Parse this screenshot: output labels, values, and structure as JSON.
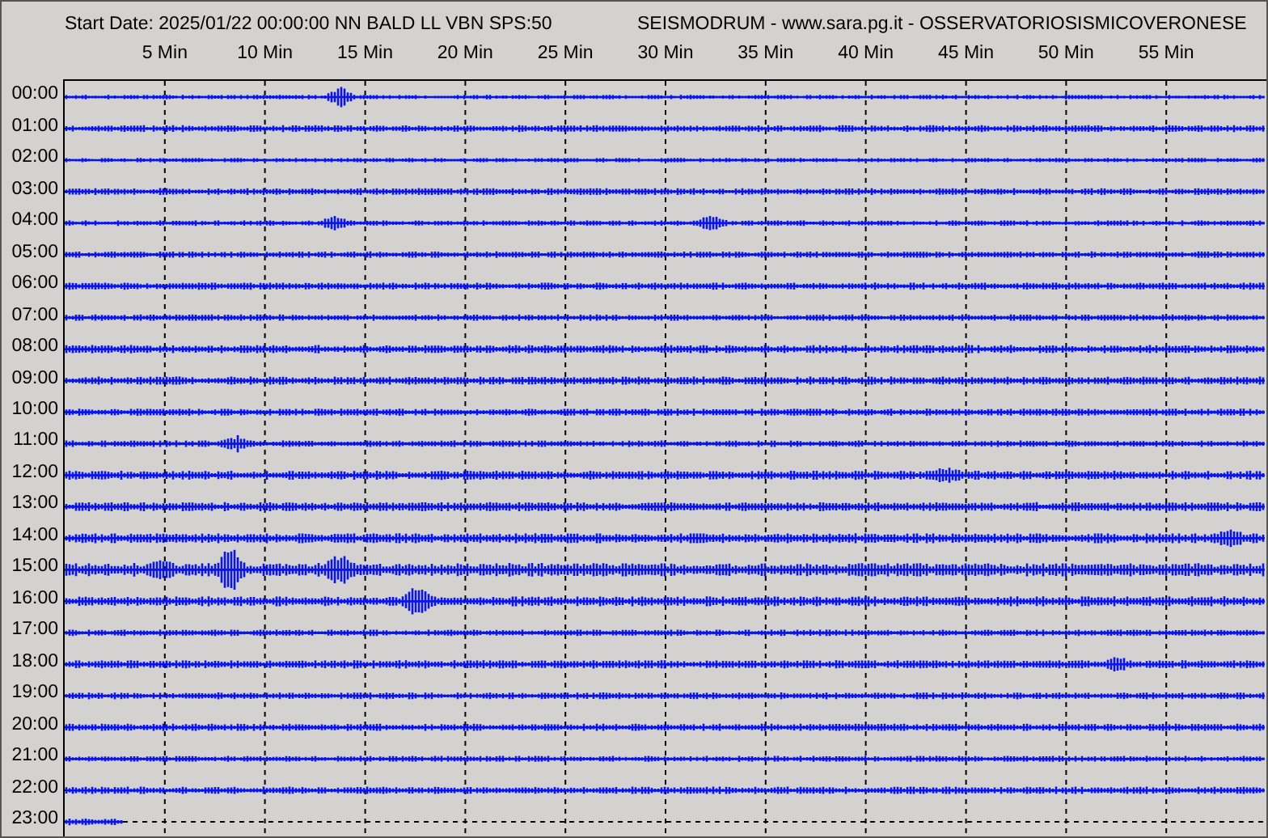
{
  "header": {
    "start_info": "Start Date: 2025/01/22 00:00:00 NN BALD LL VBN SPS:50",
    "title": "SEISMODRUM - www.sara.pg.it - OSSERVATORIOSISMICOVERONESE"
  },
  "minute_labels": [
    "5 Min",
    "10 Min",
    "15 Min",
    "20 Min",
    "25 Min",
    "30 Min",
    "35 Min",
    "40 Min",
    "45 Min",
    "50 Min",
    "55 Min"
  ],
  "hour_labels": [
    "00:00",
    "01:00",
    "02:00",
    "03:00",
    "04:00",
    "05:00",
    "06:00",
    "07:00",
    "08:00",
    "09:00",
    "10:00",
    "11:00",
    "12:00",
    "13:00",
    "14:00",
    "15:00",
    "16:00",
    "17:00",
    "18:00",
    "19:00",
    "20:00",
    "21:00",
    "22:00",
    "23:00"
  ]
}
